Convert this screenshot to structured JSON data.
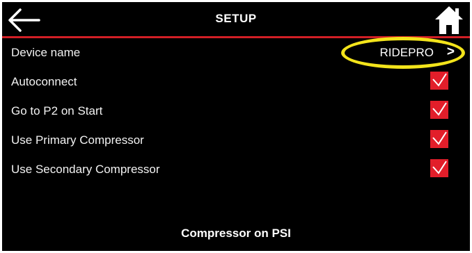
{
  "header": {
    "title": "SETUP",
    "back_icon": "arrow-left-icon",
    "home_icon": "home-icon",
    "accent_color": "#d21f26"
  },
  "settings": {
    "device_name": {
      "label": "Device name",
      "value": "RIDEPRO",
      "chevron": ">"
    },
    "items": [
      {
        "label": "Autoconnect",
        "checked": true
      },
      {
        "label": "Go to P2 on Start",
        "checked": true
      },
      {
        "label": "Use Primary Compressor",
        "checked": true
      },
      {
        "label": "Use Secondary Compressor",
        "checked": true
      }
    ]
  },
  "section": {
    "title": "Compressor on PSI"
  },
  "colors": {
    "checkbox": "#e21e2a",
    "annotation": "#f3e41b",
    "background": "#000000"
  }
}
